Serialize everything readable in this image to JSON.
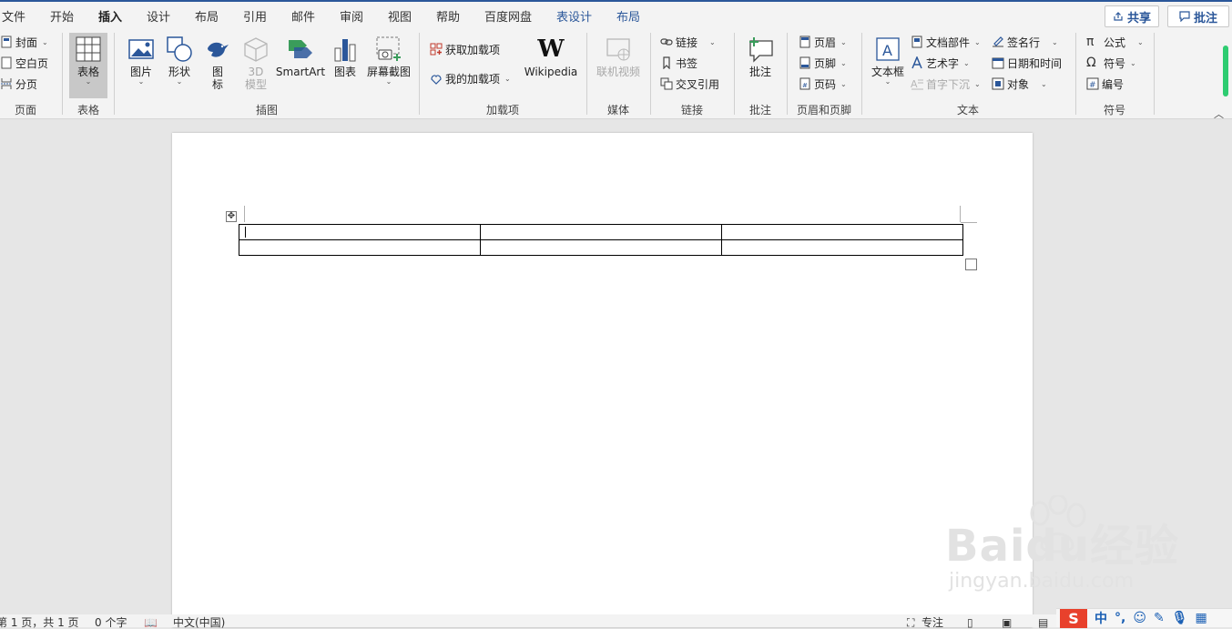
{
  "tabs": {
    "file": "文件",
    "home": "开始",
    "insert": "插入",
    "design": "设计",
    "layout": "布局",
    "references": "引用",
    "mailings": "邮件",
    "review": "审阅",
    "view": "视图",
    "help": "帮助",
    "baidu": "百度网盘",
    "table_design": "表设计",
    "table_layout": "布局"
  },
  "top_buttons": {
    "share": "共享",
    "comments": "批注"
  },
  "groups": {
    "pages": {
      "label": "页面",
      "cover": "封面",
      "blank": "空白页",
      "break": "分页"
    },
    "tables": {
      "label": "表格",
      "table": "表格"
    },
    "illustrations": {
      "label": "插图",
      "picture": "图片",
      "shapes": "形状",
      "icons": "图\n标",
      "model3d": "3D\n模型",
      "smartart": "SmartArt",
      "chart": "图表",
      "screenshot": "屏幕截图"
    },
    "addins": {
      "label": "加载项",
      "get": "获取加载项",
      "mine": "我的加载项",
      "wikipedia": "Wikipedia"
    },
    "media": {
      "label": "媒体",
      "online_video": "联机视频"
    },
    "links": {
      "label": "链接",
      "link": "链接",
      "bookmark": "书签",
      "crossref": "交叉引用"
    },
    "comments": {
      "label": "批注",
      "comment": "批注"
    },
    "header_footer": {
      "label": "页眉和页脚",
      "header": "页眉",
      "footer": "页脚",
      "page_number": "页码"
    },
    "text": {
      "label": "文本",
      "textbox": "文本框",
      "quick_parts": "文档部件",
      "wordart": "艺术字",
      "dropcap": "首字下沉",
      "signature": "签名行",
      "datetime": "日期和时间",
      "object": "对象"
    },
    "symbols": {
      "label": "符号",
      "equation": "公式",
      "symbol": "符号",
      "number": "编号"
    }
  },
  "status": {
    "page": "第 1 页，共 1 页",
    "words": "0 个字",
    "language": "中文(中国)",
    "focus": "专注"
  },
  "ime": {
    "lang": "中"
  },
  "watermark": {
    "main": "Baidu经验",
    "sub": "jingyan.baidu.com"
  },
  "colors": {
    "accent": "#2b579a",
    "ribbon_bg": "#f3f3f3",
    "canvas_bg": "#e6e6e6",
    "ime_logo": "#e8412c"
  }
}
